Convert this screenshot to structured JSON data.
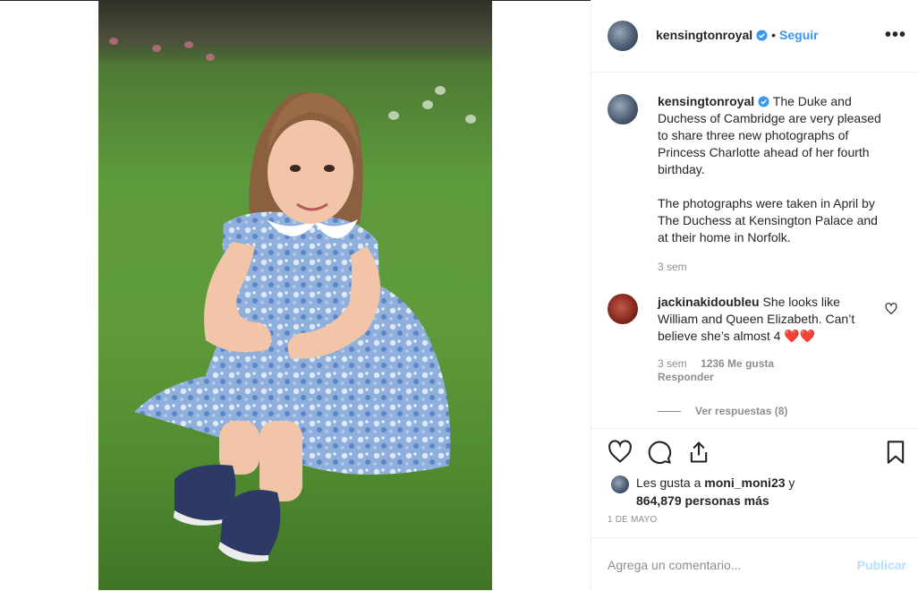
{
  "post": {
    "username": "kensingtonroyal",
    "follow_dot": "•",
    "follow_label": "Seguir",
    "more_label": "•••",
    "caption_line1": "The Duke and Duchess of Cambridge are very pleased to share three new photographs of Princess Charlotte ahead of her fourth birthday.",
    "caption_line2": "The photographs were taken in April by The Duchess at Kensington Palace and at their home in Norfolk.",
    "caption_time": "3 sem"
  },
  "comment": {
    "username": "jackinakidoubleu",
    "text": "She looks like William and Queen Elizabeth. Can’t believe she’s almost 4",
    "emoji": "❤️❤️",
    "time": "3 sem",
    "likes": "1236 Me gusta",
    "reply_label": "Responder",
    "view_replies": "Ver respuestas (8)"
  },
  "likes": {
    "prefix": "Les gusta a",
    "user": "moni_moni23",
    "conjunction": "y",
    "count": "864,879 personas más"
  },
  "date": "1 DE MAYO",
  "add_comment": {
    "placeholder": "Agrega un comentario...",
    "publish_label": "Publicar"
  },
  "icons": [
    "verified-icon",
    "more-options-icon",
    "heart-icon",
    "comment-icon",
    "share-icon",
    "bookmark-icon"
  ],
  "colors": {
    "accent": "#3897f0",
    "muted": "#8e8e8e",
    "publish_disabled": "#b2dffc",
    "emoji_heart": "#e0243a"
  }
}
